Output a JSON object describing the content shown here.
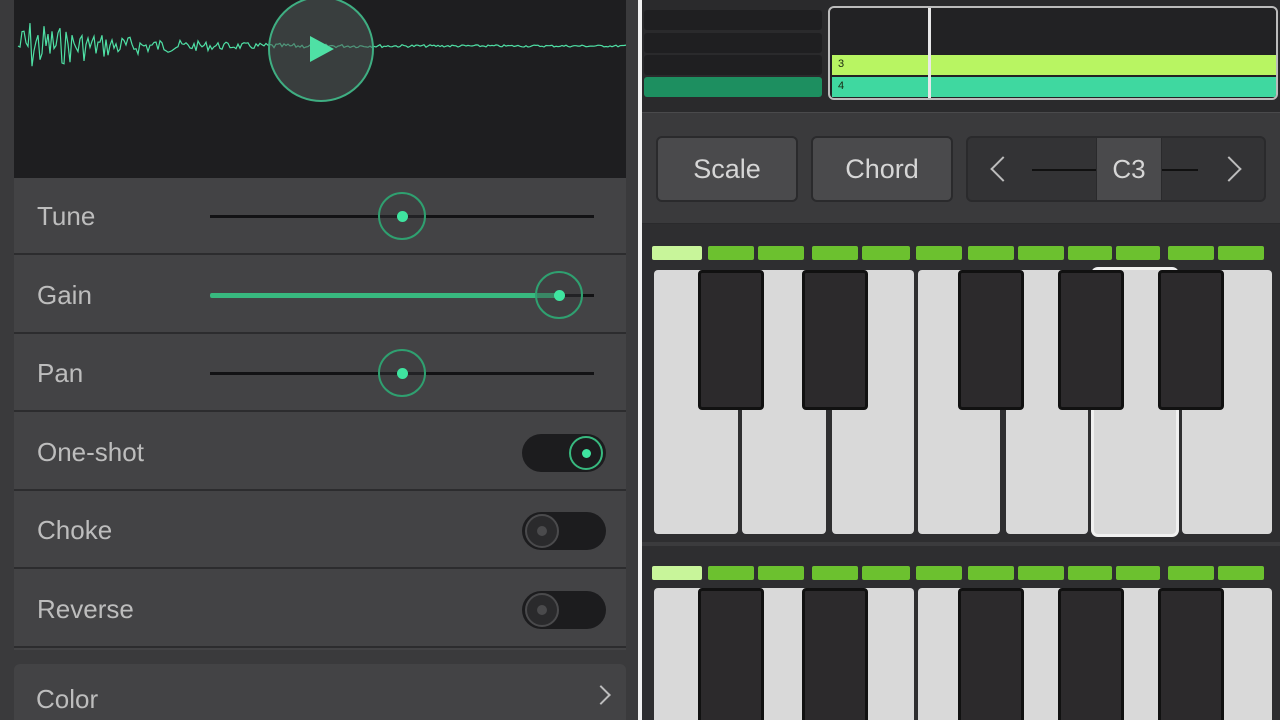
{
  "sampler": {
    "waveform": {
      "color": "#4fe0a5"
    },
    "play_button": {
      "icon": "play-icon"
    },
    "sliders": [
      {
        "label": "Tune",
        "value": 0.5
      },
      {
        "label": "Gain",
        "value": 0.91
      },
      {
        "label": "Pan",
        "value": 0.5
      }
    ],
    "toggles": [
      {
        "label": "One-shot",
        "state": "on"
      },
      {
        "label": "Choke",
        "state": "off"
      },
      {
        "label": "Reverse",
        "state": "off"
      }
    ],
    "color_row": {
      "label": "Color",
      "icon": "chevron-right-icon"
    },
    "accent_color": "#38b97f"
  },
  "keyboard_view": {
    "tracks": {
      "lanes": [
        {
          "label": "",
          "color": "#222224"
        },
        {
          "label": "",
          "color": "#222224"
        },
        {
          "label": "3",
          "color": "#b8f562"
        },
        {
          "label": "4",
          "color": "#3fd8a0"
        }
      ]
    },
    "scale_button": "Scale",
    "chord_button": "Chord",
    "octave": {
      "value": "C3",
      "left_icon": "chevron-left-icon",
      "right_icon": "chevron-right-icon"
    },
    "led_color": "#6cc12f"
  }
}
